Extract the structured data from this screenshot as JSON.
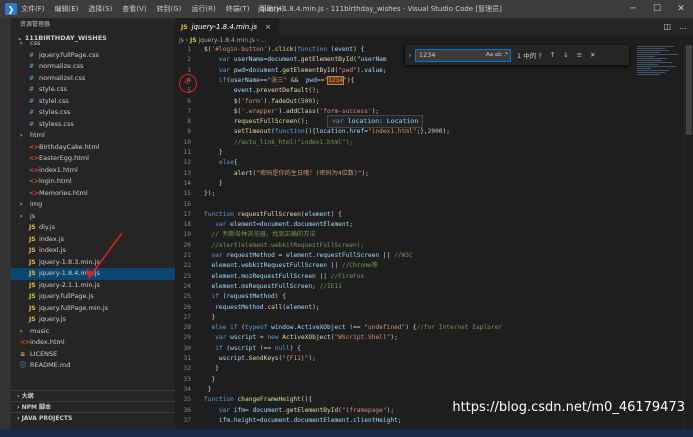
{
  "window": {
    "menu": [
      "文件(F)",
      "编辑(E)",
      "选择(S)",
      "查看(V)",
      "转到(G)",
      "运行(R)",
      "终端(T)",
      "帮助(H)"
    ],
    "title": "jquery-1.8.4.min.js - 111birthday_wishes - Visual Studio Code [管理员]"
  },
  "sidebar": {
    "title": "资源管理器",
    "folder": "111BIRTHDAY_WISHES",
    "items": [
      {
        "label": "css",
        "type": "folder"
      },
      {
        "label": "jquery.fullPage.css",
        "type": "css"
      },
      {
        "label": "normalize.css",
        "type": "css"
      },
      {
        "label": "normalizel.css",
        "type": "css"
      },
      {
        "label": "style.css",
        "type": "css"
      },
      {
        "label": "stylel.css",
        "type": "css"
      },
      {
        "label": "styles.css",
        "type": "css"
      },
      {
        "label": "styless.css",
        "type": "css"
      },
      {
        "label": "html",
        "type": "folder"
      },
      {
        "label": "BirthdayCake.html",
        "type": "html"
      },
      {
        "label": "EasterEgg.html",
        "type": "html"
      },
      {
        "label": "index1.html",
        "type": "html"
      },
      {
        "label": "login.html",
        "type": "html"
      },
      {
        "label": "Memories.html",
        "type": "html"
      },
      {
        "label": "img",
        "type": "folder"
      },
      {
        "label": "js",
        "type": "folder"
      },
      {
        "label": "diy.js",
        "type": "js"
      },
      {
        "label": "index.js",
        "type": "js"
      },
      {
        "label": "indexl.js",
        "type": "js"
      },
      {
        "label": "jquery-1.8.3.min.js",
        "type": "js"
      },
      {
        "label": "jquery-1.8.4.min.js",
        "type": "js",
        "selected": true
      },
      {
        "label": "jquery-2.1.1.min.js",
        "type": "js"
      },
      {
        "label": "jquery.fullPage.js",
        "type": "js"
      },
      {
        "label": "jquery.fullPage.min.js",
        "type": "js"
      },
      {
        "label": "jquery.js",
        "type": "js"
      },
      {
        "label": "music",
        "type": "folder"
      },
      {
        "label": "index.html",
        "type": "html"
      },
      {
        "label": "LICENSE",
        "type": "license"
      },
      {
        "label": "README.md",
        "type": "md"
      }
    ],
    "sections": [
      "大纲",
      "NPM 脚本",
      "JAVA PROJECTS"
    ]
  },
  "editor": {
    "tab_label": "jquery-1.8.4.min.js",
    "breadcrumb_root": "js",
    "breadcrumb_file": "jquery-1.8.4.min.js",
    "breadcrumb_more": "...",
    "find": {
      "query": "1234",
      "result": "1 中的 ?",
      "case_opts": "Aa ab .*"
    },
    "hover": {
      "kw": "var",
      "text": "location: Location"
    },
    "lines": [
      {
        "n": "1",
        "t": "$('#login-button').click(function (event) {"
      },
      {
        "n": "2",
        "t": "    var userName=document.getElementById(\"userNam"
      },
      {
        "n": "3",
        "t": "    var pwd=document.getElementById(\"pwd\").value;"
      },
      {
        "n": "4",
        "t": "    if(userName==\"张三\" &&  pwd==\"1234\"){"
      },
      {
        "n": "5",
        "t": "        event.preventDefault();"
      },
      {
        "n": "6",
        "t": "        $('form').fadeOut(500);"
      },
      {
        "n": "7",
        "t": "        $('.wrapper').addClass('form-success');"
      },
      {
        "n": "8",
        "t": "        requestFullScreen();"
      },
      {
        "n": "9",
        "t": "        setTimeout(function(){location.href=\"index1.html\";},2000);"
      },
      {
        "n": "10",
        "t": "        //auto_link_html(\"index1.html\");"
      },
      {
        "n": "11",
        "t": "    }"
      },
      {
        "n": "12",
        "t": "    else{"
      },
      {
        "n": "13",
        "t": "        alert(\"密码是你的生日哦！(密码为4位数)\");"
      },
      {
        "n": "14",
        "t": "    }"
      },
      {
        "n": "15",
        "t": "});"
      },
      {
        "n": "16",
        "t": ""
      },
      {
        "n": "17",
        "t": "function requestFullScreen(element) {"
      },
      {
        "n": "18",
        "t": "   var element=document.documentElement;"
      },
      {
        "n": "19",
        "t": "  // 判断各种浏览器，找到正确的方法"
      },
      {
        "n": "20",
        "t": "  //alert(element.webkitRequestFullScreen);"
      },
      {
        "n": "21",
        "t": "  var requestMethod = element.requestFullScreen || //W3C"
      },
      {
        "n": "22",
        "t": "  element.webkitRequestFullScreen || //Chrome等"
      },
      {
        "n": "23",
        "t": "  element.mozRequestFullScreen || //FireFox"
      },
      {
        "n": "24",
        "t": "  element.msRequestFullScreen; //IE11"
      },
      {
        "n": "25",
        "t": "  if (requestMethod) {"
      },
      {
        "n": "26",
        "t": "   requestMethod.call(element);"
      },
      {
        "n": "27",
        "t": "  }"
      },
      {
        "n": "28",
        "t": "  else if (typeof window.ActiveXObject !== \"undefined\") {//for Internet Explorer"
      },
      {
        "n": "29",
        "t": "   var wscript = new ActiveXObject(\"WScript.Shell\");"
      },
      {
        "n": "30",
        "t": "   if (wscript !== null) {"
      },
      {
        "n": "31",
        "t": "    wscript.SendKeys(\"{F11}\");"
      },
      {
        "n": "32",
        "t": "   }"
      },
      {
        "n": "33",
        "t": "  }"
      },
      {
        "n": "34",
        "t": " }"
      },
      {
        "n": "35",
        "t": "function changeFrameHeight(){"
      },
      {
        "n": "36",
        "t": "    var ifm= document.getElementById(\"iframepage\");"
      },
      {
        "n": "37",
        "t": "    ifm.height=document.documentElement.clientHeight;"
      }
    ]
  },
  "watermark": "https://blog.csdn.net/m0_46179473",
  "annotation": {
    "circle_label": "4"
  },
  "colors": {
    "accent": "#007acc",
    "selection": "#094771",
    "annotation": "#e02020"
  }
}
